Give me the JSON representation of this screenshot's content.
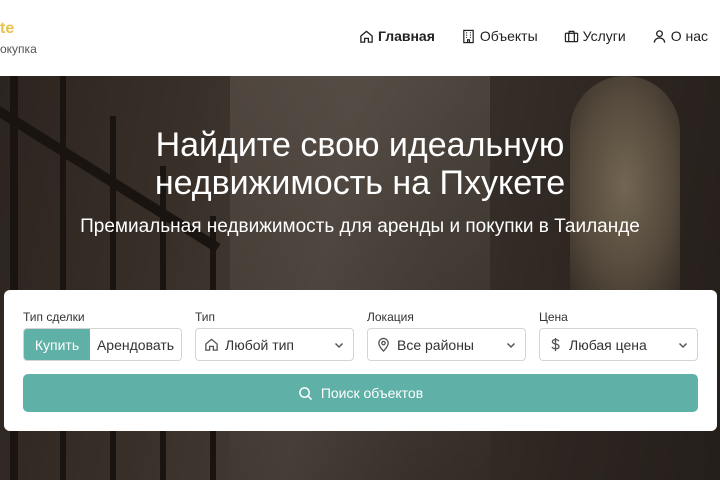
{
  "brand": {
    "line1": "te",
    "line2": "окупка",
    "accent": "#e9c24a"
  },
  "nav": [
    {
      "label": "Главная",
      "icon": "home-icon",
      "active": true
    },
    {
      "label": "Объекты",
      "icon": "building-icon",
      "active": false
    },
    {
      "label": "Услуги",
      "icon": "briefcase-icon",
      "active": false
    },
    {
      "label": "О нас",
      "icon": "user-icon",
      "active": false
    }
  ],
  "hero": {
    "title_line1": "Найдите свою идеальную",
    "title_line2": "недвижимость на Пхукете",
    "subtitle": "Премиальная недвижимость для аренды и покупки в Таиланде"
  },
  "search": {
    "deal_label": "Тип сделки",
    "deal_options": [
      "Купить",
      "Арендовать"
    ],
    "deal_selected": "Купить",
    "type_label": "Тип",
    "type_value": "Любой тип",
    "location_label": "Локация",
    "location_value": "Все районы",
    "price_label": "Цена",
    "price_value": "Любая цена",
    "submit_label": "Поиск объектов",
    "accent": "#5fb0a6"
  }
}
